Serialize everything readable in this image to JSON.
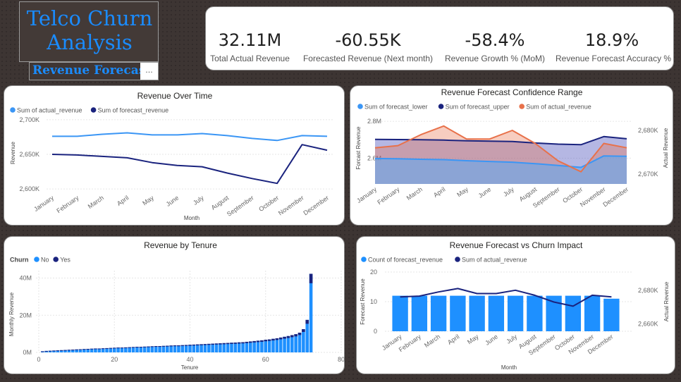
{
  "header": {
    "title_line1": "Telco Churn",
    "title_line2": "Analysis",
    "subtitle": "Revenue Forecast",
    "more": "..."
  },
  "kpis": [
    {
      "value": "32.11M",
      "label": "Total Actual Revenue"
    },
    {
      "value": "-60.55K",
      "label": "Forecasted Revenue (Next month)"
    },
    {
      "value": "-58.4%",
      "label": "Revenue Growth % (MoM)"
    },
    {
      "value": "18.9%",
      "label": "Revenue Forecast Accuracy %"
    }
  ],
  "colors": {
    "light_blue": "#3b96f5",
    "dark_blue": "#1a237e",
    "orange": "#e8714a",
    "bar_blue": "#1e90ff"
  },
  "chart_data": [
    {
      "type": "line",
      "title": "Revenue Over Time",
      "xlabel": "Month",
      "ylabel": "Revenue",
      "categories": [
        "January",
        "February",
        "March",
        "April",
        "May",
        "June",
        "July",
        "August",
        "September",
        "October",
        "November",
        "December"
      ],
      "series": [
        {
          "name": "Sum of actual_revenue",
          "values": [
            2676,
            2676,
            2679,
            2681,
            2678,
            2678,
            2680,
            2677,
            2673,
            2670,
            2677,
            2676
          ]
        },
        {
          "name": "Sum of forecast_revenue",
          "values": [
            2650,
            2649,
            2647,
            2645,
            2638,
            2634,
            2632,
            2623,
            2615,
            2608,
            2664,
            2656
          ]
        }
      ],
      "ylim": [
        2595,
        2710
      ],
      "yticks": [
        "2,600K",
        "2,650K",
        "2,700K"
      ],
      "legend": "top-left"
    },
    {
      "type": "area",
      "title": "Revenue Forecast Confidence Range",
      "xlabel": "",
      "ylabel_left": "Forcast Revenue",
      "ylabel_right": "Actual Revenue",
      "categories": [
        "January",
        "February",
        "March",
        "April",
        "May",
        "June",
        "July",
        "August",
        "September",
        "October",
        "November",
        "December"
      ],
      "series": [
        {
          "name": "Sum of forecast_lower",
          "values": [
            2.598,
            2.597,
            2.594,
            2.592,
            2.586,
            2.582,
            2.578,
            2.57,
            2.56,
            2.55,
            2.612,
            2.61
          ]
        },
        {
          "name": "Sum of forecast_upper",
          "values": [
            2.702,
            2.701,
            2.7,
            2.698,
            2.694,
            2.692,
            2.69,
            2.682,
            2.676,
            2.673,
            2.717,
            2.705
          ]
        },
        {
          "name": "Sum of actual_revenue",
          "values": [
            2676,
            2676.5,
            2679,
            2681,
            2678,
            2678,
            2680,
            2677,
            2673,
            2670.5,
            2677,
            2676
          ]
        }
      ],
      "ylim_left": [
        2.46,
        2.85
      ],
      "ylim_right": [
        2667.7,
        2684.2
      ],
      "yticks_left": [
        "2.6M",
        "2.8M"
      ],
      "yticks_right": [
        "2,670K",
        "2,680K"
      ],
      "legend": "top-left"
    },
    {
      "type": "bar",
      "title": "Revenue by Tenure",
      "xlabel": "Tenure",
      "ylabel": "Monthly Revenue",
      "legend_title": "Churn",
      "series": [
        {
          "name": "No"
        },
        {
          "name": "Yes"
        }
      ],
      "xlim": [
        0,
        80
      ],
      "ylim": [
        0,
        44
      ],
      "xticks": [
        "0",
        "20",
        "40",
        "60",
        "80"
      ],
      "yticks": [
        "0M",
        "20M",
        "40M"
      ],
      "x": [
        1,
        2,
        3,
        4,
        5,
        6,
        7,
        8,
        9,
        10,
        11,
        12,
        13,
        14,
        15,
        16,
        17,
        18,
        19,
        20,
        21,
        22,
        23,
        24,
        25,
        26,
        27,
        28,
        29,
        30,
        31,
        32,
        33,
        34,
        35,
        36,
        37,
        38,
        39,
        40,
        41,
        42,
        43,
        44,
        45,
        46,
        47,
        48,
        49,
        50,
        51,
        52,
        53,
        54,
        55,
        56,
        57,
        58,
        59,
        60,
        61,
        62,
        63,
        64,
        65,
        66,
        67,
        68,
        69,
        70,
        71,
        72
      ],
      "values": [
        0.6,
        0.8,
        0.9,
        1.0,
        1.1,
        1.2,
        1.3,
        1.4,
        1.5,
        1.6,
        1.7,
        1.8,
        1.9,
        2.0,
        2.1,
        2.1,
        2.2,
        2.3,
        2.4,
        2.5,
        2.6,
        2.6,
        2.7,
        2.8,
        2.9,
        3.0,
        3.0,
        3.1,
        3.2,
        3.3,
        3.4,
        3.4,
        3.5,
        3.6,
        3.7,
        3.8,
        3.8,
        3.9,
        4.0,
        4.1,
        4.2,
        4.3,
        4.4,
        4.5,
        4.6,
        4.7,
        4.8,
        4.9,
        5.0,
        5.1,
        5.2,
        5.3,
        5.4,
        5.5,
        5.7,
        5.9,
        6.1,
        6.3,
        6.5,
        6.8,
        7.0,
        7.3,
        7.6,
        8.0,
        8.4,
        8.8,
        9.3,
        9.8,
        10.6,
        12.5,
        17.5,
        42.3
      ]
    },
    {
      "type": "bar",
      "title": "Revenue Forecast vs Churn Impact",
      "xlabel": "Month",
      "ylabel_left": "Forecast Revenue",
      "ylabel_right": "Actual Revenue",
      "categories": [
        "January",
        "February",
        "March",
        "April",
        "May",
        "June",
        "July",
        "August",
        "September",
        "October",
        "November",
        "December"
      ],
      "series": [
        {
          "name": "Count of forecast_revenue",
          "values": [
            12,
            12,
            12,
            12,
            12,
            12,
            12,
            12,
            12,
            12,
            12,
            11
          ]
        },
        {
          "name": "Sum of actual_revenue",
          "values": [
            2676,
            2676.5,
            2679,
            2681,
            2678,
            2678,
            2680,
            2677,
            2673,
            2670.5,
            2677,
            2676
          ]
        }
      ],
      "ylim_left": [
        0,
        20
      ],
      "ylim_right": [
        2655.6,
        2690.8
      ],
      "yticks_left": [
        "0",
        "10",
        "20"
      ],
      "yticks_right": [
        "2,660K",
        "2,680K"
      ],
      "legend": "top-left"
    }
  ]
}
